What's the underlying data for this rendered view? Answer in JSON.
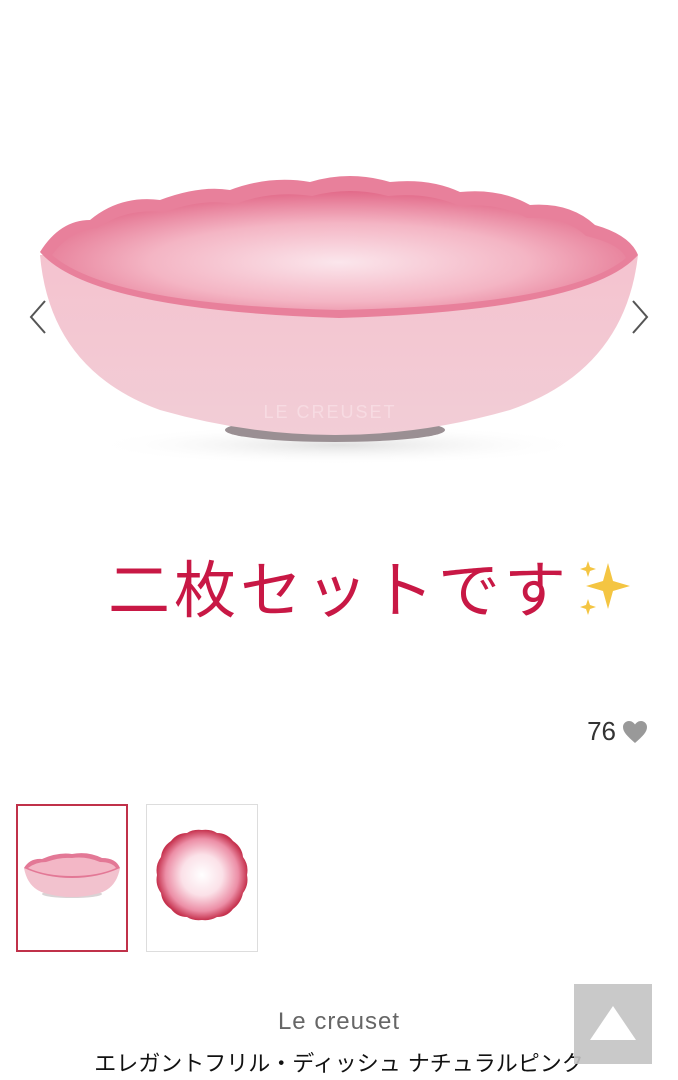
{
  "gallery": {
    "prev_icon": "chevron-left-icon",
    "next_icon": "chevron-right-icon",
    "embossed_logo": "LE CREUSET"
  },
  "promo": {
    "text": "二枚セットです",
    "emoji": "sparkles-icon",
    "color": "#c81845"
  },
  "likes": {
    "count": "76",
    "icon": "heart-icon"
  },
  "thumbnails": {
    "selected_index": 0,
    "items": [
      {
        "name": "side-view"
      },
      {
        "name": "top-view"
      }
    ],
    "selected_border": "#c0314a"
  },
  "product": {
    "brand": "Le creuset",
    "name": "エレガントフリル・ディッシュ ナチュラルピンク"
  },
  "scroll_top": {
    "icon": "triangle-up-icon"
  }
}
